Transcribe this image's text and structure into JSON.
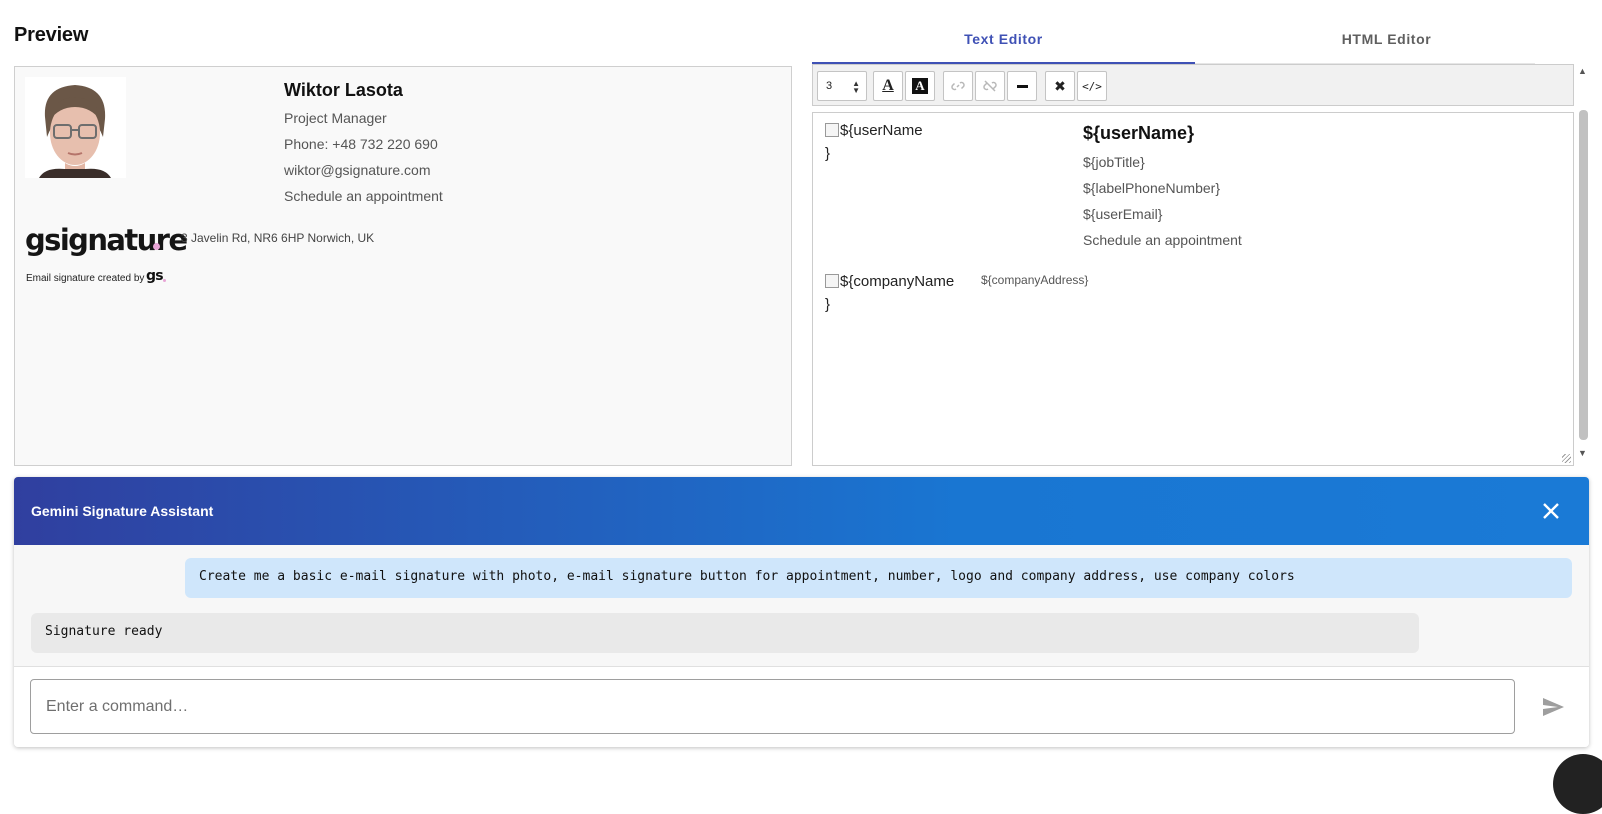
{
  "preview": {
    "title": "Preview",
    "signature": {
      "name": "Wiktor Lasota",
      "job_title": "Project Manager",
      "phone": "Phone: +48 732 220 690",
      "email": "wiktor@gsignature.com",
      "appointment": "Schedule an appointment",
      "logo_text": "gsignature",
      "address": "3 Javelin Rd, NR6 6HP Norwich, UK",
      "created_by": "Email signature created by",
      "created_by_logo": "gs"
    }
  },
  "editor": {
    "tabs": [
      {
        "label": "Text Editor",
        "active": true
      },
      {
        "label": "HTML Editor",
        "active": false
      }
    ],
    "toolbar": {
      "font_size": "3",
      "buttons": [
        {
          "name": "font-color",
          "icon": "text-color-icon",
          "enabled": true
        },
        {
          "name": "background-color",
          "icon": "text-highlight-icon",
          "enabled": true
        },
        {
          "name": "link",
          "icon": "link-icon",
          "enabled": false
        },
        {
          "name": "unlink",
          "icon": "unlink-icon",
          "enabled": false
        },
        {
          "name": "horizontal-rule",
          "icon": "horizontal-rule-icon",
          "enabled": true
        },
        {
          "name": "remove-format",
          "icon": "close-icon",
          "enabled": true
        },
        {
          "name": "code-view",
          "icon": "code-icon",
          "enabled": true
        }
      ]
    },
    "content": {
      "photo_alt": "${userName",
      "photo_alt_end": "}",
      "name": "${userName}",
      "job_title": "${jobTitle}",
      "phone": "${labelPhoneNumber}",
      "email": "${userEmail}",
      "appointment": "Schedule an appointment",
      "logo_alt": "${companyName",
      "logo_alt_end": "}",
      "address": "${companyAddress}"
    }
  },
  "assistant": {
    "title": "Gemini Signature Assistant",
    "messages": [
      {
        "role": "user",
        "text": "Create me a basic e-mail signature with photo, e-mail signature button for appointment, number, logo and company address, use company colors"
      },
      {
        "role": "assistant",
        "text": "Signature ready"
      }
    ],
    "input_placeholder": "Enter a command…"
  },
  "colors": {
    "accent": "#3f51b5",
    "header_start": "#303f9f",
    "header_end": "#1976d2",
    "user_bubble": "#cfe6fb",
    "bot_bubble": "#e9e9e9",
    "logo_dot": "#e8a5d6"
  }
}
